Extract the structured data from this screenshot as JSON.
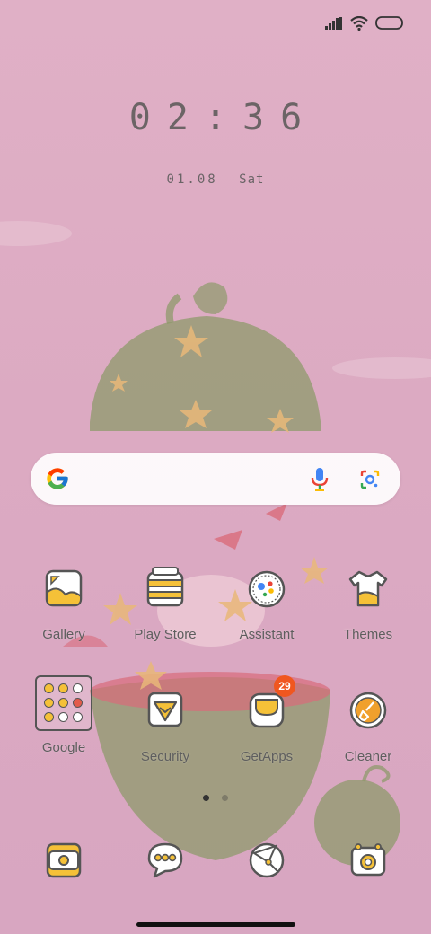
{
  "status_bar": {
    "icons": [
      "cellular-signal-icon",
      "wifi-icon",
      "battery-icon"
    ]
  },
  "clock": {
    "time": "02:36",
    "date": "01.08",
    "weekday": "Sat"
  },
  "search_bar": {
    "icons": [
      "google-g-icon",
      "microphone-icon",
      "google-lens-icon"
    ]
  },
  "apps_row1": [
    {
      "label": "Gallery",
      "icon": "gallery-icon"
    },
    {
      "label": "Play Store",
      "icon": "play-store-icon"
    },
    {
      "label": "Assistant",
      "icon": "assistant-icon"
    },
    {
      "label": "Themes",
      "icon": "themes-icon"
    }
  ],
  "apps_row2": [
    {
      "label": "Google",
      "icon": "folder-icon"
    },
    {
      "label": "Security",
      "icon": "security-icon"
    },
    {
      "label": "GetApps",
      "icon": "getapps-icon",
      "badge": "29"
    },
    {
      "label": "Cleaner",
      "icon": "cleaner-icon"
    }
  ],
  "dock": [
    {
      "icon": "phone-icon"
    },
    {
      "icon": "messages-icon"
    },
    {
      "icon": "browser-icon"
    },
    {
      "icon": "camera-icon"
    }
  ],
  "page_indicator": {
    "current": 1,
    "total": 2
  },
  "colors": {
    "background": "#dcaac2",
    "accent_yellow": "#f5c138",
    "outline": "#555555",
    "badge": "#f0571f"
  }
}
